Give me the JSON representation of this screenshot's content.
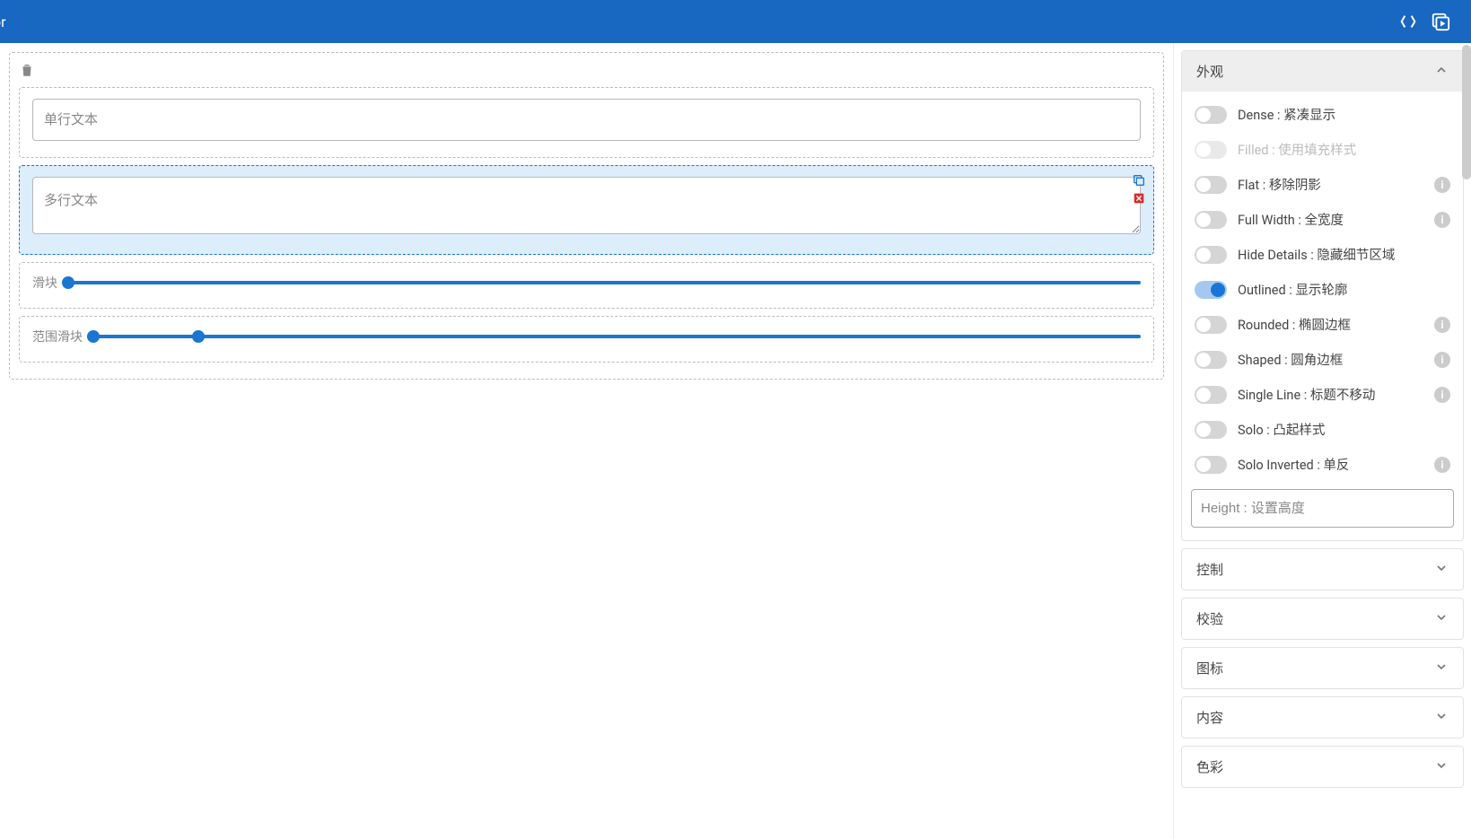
{
  "header": {
    "title": "or"
  },
  "canvas": {
    "fields": [
      {
        "type": "text",
        "label": "单行文本"
      },
      {
        "type": "textarea",
        "label": "多行文本",
        "selected": true
      },
      {
        "type": "slider",
        "label": "滑块"
      },
      {
        "type": "range",
        "label": "范围滑块"
      }
    ]
  },
  "panel": {
    "sections": {
      "appearance": {
        "title": "外观",
        "expanded": true,
        "props": [
          {
            "key": "dense",
            "label": "Dense : 紧凑显示",
            "on": false,
            "info": false,
            "disabled": false
          },
          {
            "key": "filled",
            "label": "Filled : 使用填充样式",
            "on": false,
            "info": false,
            "disabled": true
          },
          {
            "key": "flat",
            "label": "Flat : 移除阴影",
            "on": false,
            "info": true,
            "disabled": false
          },
          {
            "key": "fullwidth",
            "label": "Full Width : 全宽度",
            "on": false,
            "info": true,
            "disabled": false
          },
          {
            "key": "hidedetails",
            "label": "Hide Details : 隐藏细节区域",
            "on": false,
            "info": false,
            "disabled": false
          },
          {
            "key": "outlined",
            "label": "Outlined : 显示轮廓",
            "on": true,
            "info": false,
            "disabled": false
          },
          {
            "key": "rounded",
            "label": "Rounded : 椭圆边框",
            "on": false,
            "info": true,
            "disabled": false
          },
          {
            "key": "shaped",
            "label": "Shaped : 圆角边框",
            "on": false,
            "info": true,
            "disabled": false
          },
          {
            "key": "singleline",
            "label": "Single Line : 标题不移动",
            "on": false,
            "info": true,
            "disabled": false
          },
          {
            "key": "solo",
            "label": "Solo : 凸起样式",
            "on": false,
            "info": false,
            "disabled": false
          },
          {
            "key": "soloinverted",
            "label": "Solo Inverted : 单反",
            "on": false,
            "info": true,
            "disabled": false
          }
        ],
        "height_placeholder": "Height : 设置高度"
      },
      "collapsed": [
        {
          "key": "control",
          "title": "控制"
        },
        {
          "key": "validate",
          "title": "校验"
        },
        {
          "key": "icon",
          "title": "图标"
        },
        {
          "key": "content",
          "title": "内容"
        },
        {
          "key": "color",
          "title": "色彩"
        }
      ]
    }
  }
}
